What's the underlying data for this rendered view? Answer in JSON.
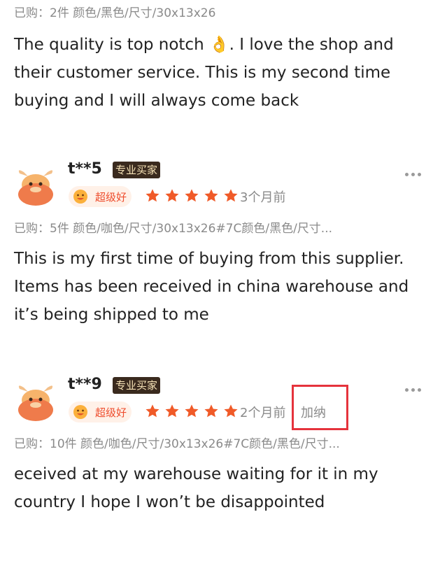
{
  "review0": {
    "meta": "已购：2件  颜色/黑色/尺寸/30x13x26",
    "text": "The quality is top notch 👌. I love the shop and their customer service. This is my second time buying and I will always come back"
  },
  "reviews": [
    {
      "name": "t**5",
      "badge": "专业买家",
      "level": "超级好",
      "rating": 5,
      "time": "3个月前",
      "region": "",
      "meta": "已购：5件  颜色/咖色/尺寸/30x13x26#7C颜色/黑色/尺寸...",
      "text": "This is my first time of buying from this supplier. Items has been received in china warehouse and it’s being shipped to me"
    },
    {
      "name": "t**9",
      "badge": "专业买家",
      "level": "超级好",
      "rating": 5,
      "time": "2个月前",
      "region": "加纳",
      "meta": "已购：10件  颜色/咖色/尺寸/30x13x26#7C颜色/黑色/尺寸...",
      "text": "eceived at my warehouse waiting for it in my country I hope I won’t be disappointed"
    }
  ],
  "colors": {
    "accent": "#ee4d2d",
    "star": "#f05a28",
    "badge_bg": "#3a2a1e",
    "highlight": "#e5333c"
  },
  "icons": {
    "avatar": "cow-avatar-icon",
    "more": "more-dots-icon",
    "level": "smile-face-icon",
    "star": "star-icon"
  }
}
